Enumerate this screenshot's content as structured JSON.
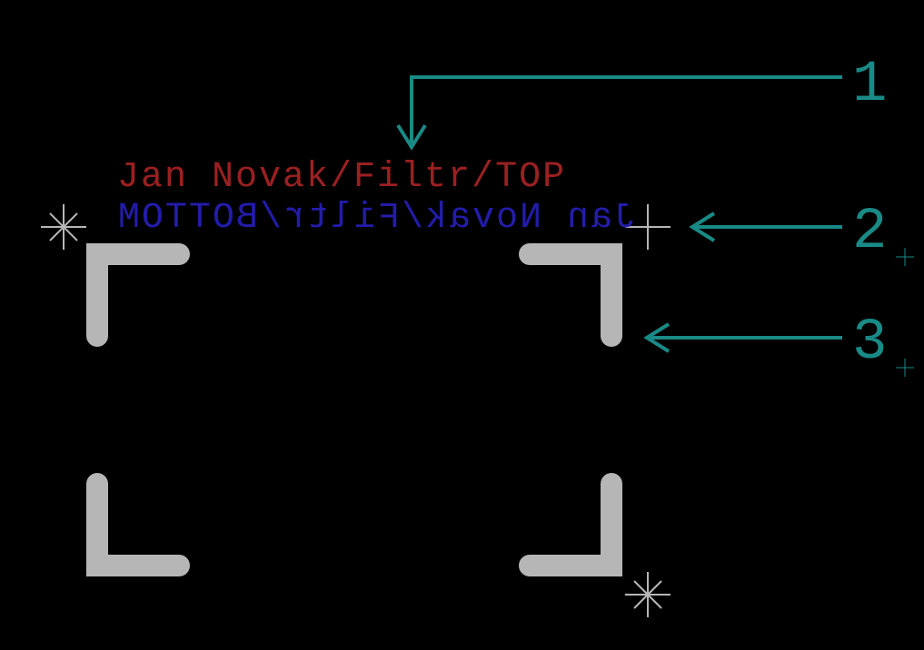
{
  "labels": {
    "top_text": "Jan Novak/Filtr/TOP",
    "bottom_text": "Jan Novak/Filtr/BOTTOM"
  },
  "callouts": {
    "c1": "1",
    "c2": "2",
    "c3": "3"
  },
  "colors": {
    "top_silkscreen": "#9b2022",
    "bottom_silkscreen": "#231caa",
    "callout": "#198a86",
    "board_outline": "#b6b6b6"
  }
}
